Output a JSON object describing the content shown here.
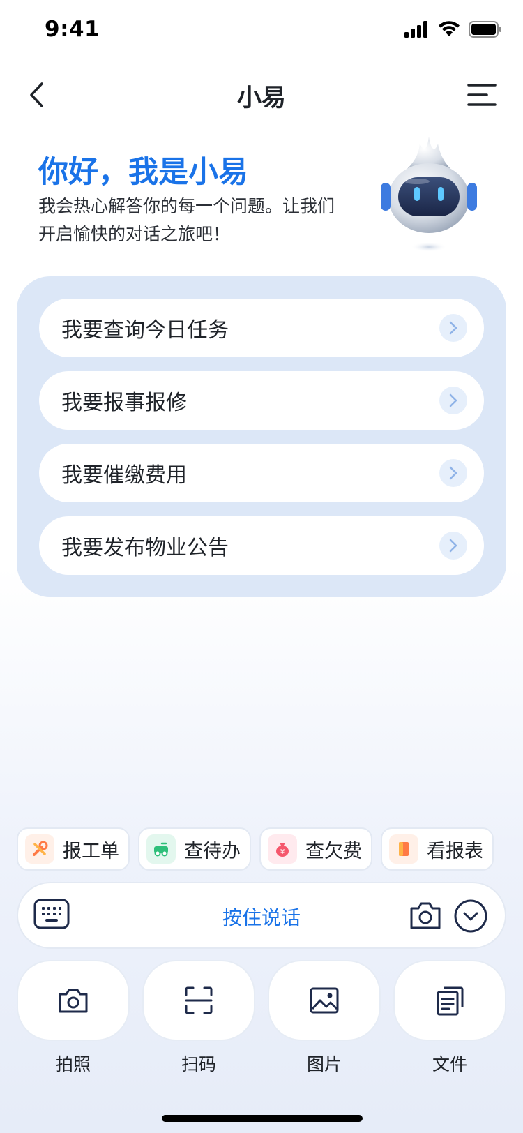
{
  "status_bar": {
    "time": "9:41"
  },
  "nav": {
    "title": "小易"
  },
  "greeting": {
    "title": "你好，我是小易",
    "subtitle": "我会热心解答你的每一个问题。让我们开启愉快的对话之旅吧！"
  },
  "quick_questions": [
    {
      "label": "我要查询今日任务"
    },
    {
      "label": "我要报事报修"
    },
    {
      "label": "我要催缴费用"
    },
    {
      "label": "我要发布物业公告"
    }
  ],
  "shortcuts": [
    {
      "label": "报工单",
      "icon": "wrench-icon",
      "color": "#ff7a45",
      "bg": "#fff0e8"
    },
    {
      "label": "查待办",
      "icon": "todo-icon",
      "color": "#2fbf7a",
      "bg": "#e3f7ee"
    },
    {
      "label": "查欠费",
      "icon": "money-bag-icon",
      "color": "#f5576c",
      "bg": "#ffeaee"
    },
    {
      "label": "看报表",
      "icon": "report-icon",
      "color": "#ff7a45",
      "bg": "#fff0e8"
    }
  ],
  "input_bar": {
    "hold_to_talk_label": "按住说话"
  },
  "tools": [
    {
      "label": "拍照",
      "icon": "camera-icon"
    },
    {
      "label": "扫码",
      "icon": "scan-icon"
    },
    {
      "label": "图片",
      "icon": "image-icon"
    },
    {
      "label": "文件",
      "icon": "file-icon"
    }
  ],
  "colors": {
    "accent": "#1a73e8",
    "panel": "#dce7f7",
    "icon_dark": "#1e2a4a"
  }
}
